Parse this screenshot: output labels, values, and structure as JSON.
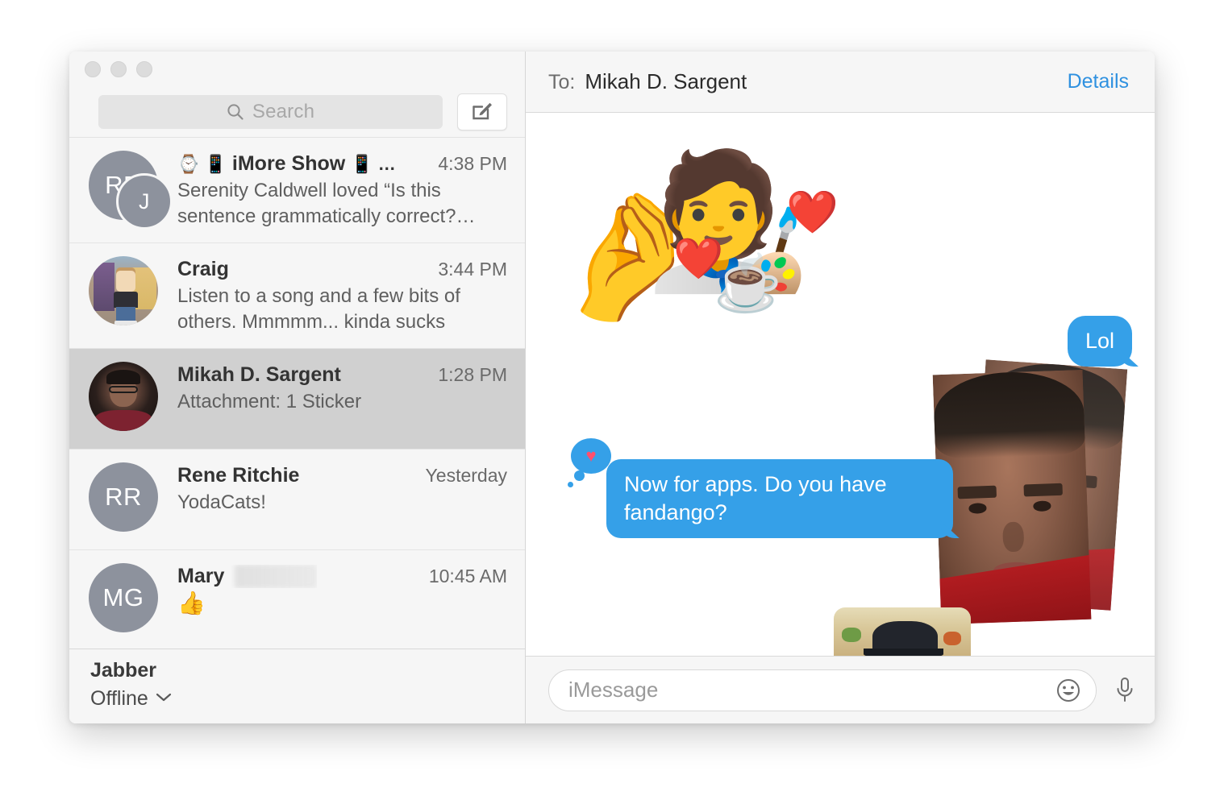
{
  "window": {
    "traffic_lights": [
      "close",
      "minimize",
      "zoom"
    ]
  },
  "sidebar": {
    "search": {
      "placeholder": "Search",
      "icon": "search-icon"
    },
    "compose": {
      "icon": "compose-pencil-icon",
      "label": "New Message"
    },
    "conversations": [
      {
        "id": "imore-show",
        "title": "iMore Show",
        "title_prefix_icons": "⌚ 📱",
        "title_suffix_icons": "📱 …",
        "time": "4:38 PM",
        "preview": "Serenity Caldwell loved “Is this sentence grammatically correct?…",
        "avatar_type": "group-initials",
        "avatar_initials": [
          "RR",
          "J"
        ],
        "selected": false
      },
      {
        "id": "craig",
        "title": "Craig",
        "time": "3:44 PM",
        "preview": "Listen to a song and a few bits of others. Mmmmm... kinda sucks",
        "avatar_type": "bitmoji",
        "selected": false
      },
      {
        "id": "mikah-d-sargent",
        "title": "Mikah D. Sargent",
        "time": "1:28 PM",
        "preview": "Attachment: 1 Sticker",
        "avatar_type": "photo",
        "selected": true
      },
      {
        "id": "rene-ritchie",
        "title": "Rene Ritchie",
        "time": "Yesterday",
        "preview": "YodaCats!",
        "avatar_type": "initials",
        "avatar_initials": [
          "RR"
        ],
        "selected": false
      },
      {
        "id": "mary",
        "title": "Mary",
        "title_redacted_suffix": "Jo Foley",
        "time": "10:45 AM",
        "preview": "👍",
        "preview_is_emoji": true,
        "avatar_type": "initials",
        "avatar_initials": [
          "MG"
        ],
        "selected": false
      }
    ],
    "footer": {
      "account_name": "Jabber",
      "status": "Offline",
      "status_chevron": "chevron-down-icon"
    }
  },
  "chat": {
    "to_label": "To:",
    "recipient": "Mikah D. Sargent",
    "details_label": "Details",
    "stickers": [
      {
        "id": "chef-kiss-emoji",
        "glyph": "🤌",
        "note": "chef hat kissing face"
      },
      {
        "id": "rainbow-hat-emoji",
        "glyph": "🧑‍🎨",
        "note": "rainbow hat face with coffee"
      },
      {
        "id": "heart-emoji-1",
        "glyph": "❤️"
      },
      {
        "id": "heart-emoji-2",
        "glyph": "❤️"
      },
      {
        "id": "coffee-emoji",
        "glyph": "☕"
      }
    ],
    "messages": [
      {
        "id": "msg-lol",
        "text": "Lol",
        "direction": "sent",
        "has_tail": true
      },
      {
        "id": "msg-fandango",
        "text": "Now for apps. Do you have fandango?",
        "direction": "sent",
        "tapback": "heart",
        "tapback_icon": "heart-tapback-icon"
      }
    ],
    "photo_stickers": [
      {
        "id": "face-sticker-back",
        "note": "photo sticker of person in red shirt"
      },
      {
        "id": "face-sticker-front",
        "note": "photo sticker of person in red shirt"
      },
      {
        "id": "food-hat-sticker",
        "note": "partially visible photo sticker, person with black cap"
      }
    ]
  },
  "compose": {
    "placeholder": "iMessage",
    "value": "",
    "emoji_icon": "smiley-face-icon",
    "mic_icon": "microphone-icon"
  },
  "colors": {
    "accent_blue": "#35a0e8",
    "link_blue": "#2f91e0",
    "selected_row": "#d0d0d0",
    "sidebar_bg": "#f6f6f6",
    "avatar_gray": "#8d929d"
  }
}
